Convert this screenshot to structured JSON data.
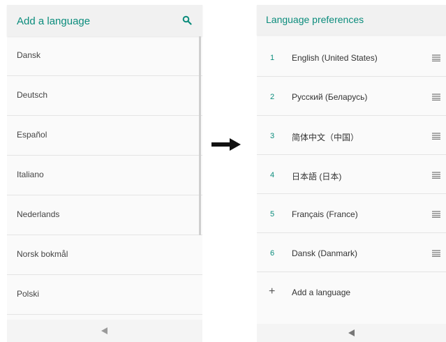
{
  "left_screen": {
    "title": "Add a language",
    "languages": [
      "Dansk",
      "Deutsch",
      "Español",
      "Italiano",
      "Nederlands",
      "Norsk bokmål",
      "Polski"
    ]
  },
  "right_screen": {
    "title": "Language preferences",
    "preferences": [
      {
        "num": "1",
        "label": "English (United States)"
      },
      {
        "num": "2",
        "label": "Русский (Беларусь)"
      },
      {
        "num": "3",
        "label": "简体中文（中国）"
      },
      {
        "num": "4",
        "label": "日本語 (日本)"
      },
      {
        "num": "5",
        "label": "Français (France)"
      },
      {
        "num": "6",
        "label": "Dansk (Danmark)"
      }
    ],
    "add_label": "Add a language"
  },
  "colors": {
    "accent": "#0b8c7c"
  }
}
